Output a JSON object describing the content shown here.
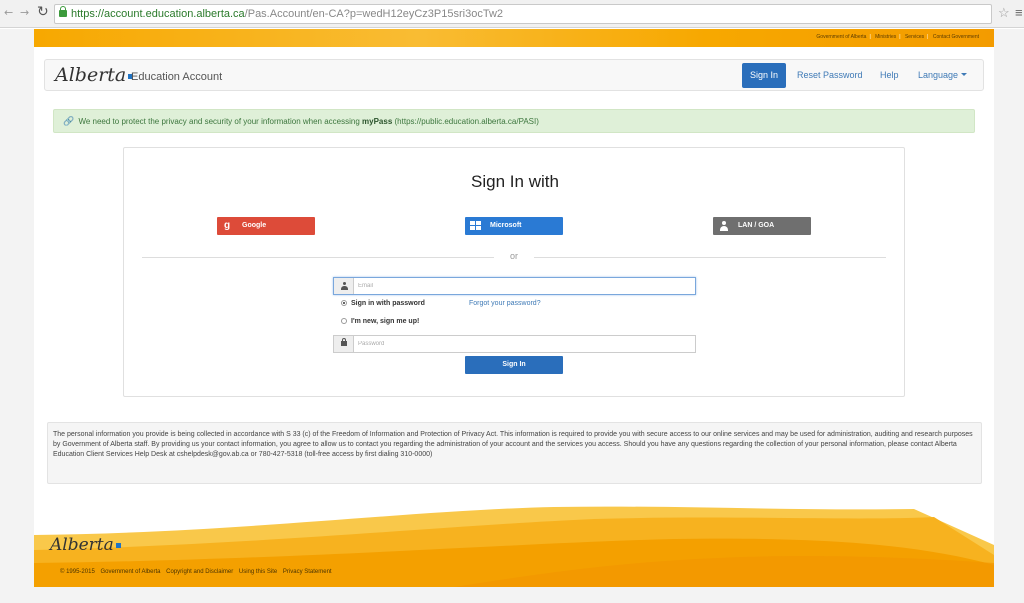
{
  "browser": {
    "url_host": "https://account.education.alberta.ca",
    "url_path": "/Pas.Account/en-CA?p=wedH12eyCz3P15sri3ocTw2"
  },
  "gov_links": [
    "Government of Alberta",
    "Ministries",
    "Services",
    "Contact Government"
  ],
  "navbar": {
    "logo": "Alberta",
    "title": "Education Account",
    "signin": "Sign In",
    "reset_password": "Reset Password",
    "help": "Help",
    "language": "Language"
  },
  "alert": {
    "text": "We need to protect the privacy and security of your information when accessing",
    "mypass": "myPass",
    "url": "(https://public.education.alberta.ca/PASI)"
  },
  "signin_panel": {
    "title": "Sign In with",
    "providers": {
      "google": "Google",
      "microsoft": "Microsoft",
      "lan": "LAN / GOA"
    },
    "or": "or",
    "email_placeholder": "Email",
    "radio_password": "Sign in with password",
    "radio_new": "I'm new, sign me up!",
    "forgot": "Forgot your password?",
    "password_placeholder": "Password",
    "signin_button": "Sign In"
  },
  "disclaimer": "The personal information you provide is being collected in accordance with S 33 (c) of the Freedom of Information and Protection of Privacy Act. This information is required to provide you with secure access to our online services and may be used for administration, auditing and research purposes by Government of Alberta staff. By providing us your contact information, you agree to allow us to contact you regarding the administration of your account and the services you access. Should you have any questions regarding the collection of your personal information, please contact Alberta Education Client Services Help Desk at cshelpdesk@gov.ab.ca or 780-427-5318 (toll-free access by first dialing 310-0000)",
  "footer": {
    "logo": "Alberta",
    "copyright": "© 1995-2015",
    "links": [
      "Government of Alberta",
      "Copyright and Disclaimer",
      "Using this Site",
      "Privacy Statement"
    ]
  },
  "colors": {
    "brand_blue": "#2a6ebb",
    "gov_yellow": "#f7a800",
    "google_red": "#dd4b39",
    "microsoft_blue": "#2a7ad4",
    "lan_gray": "#6f6f6f",
    "alert_green": "#dff0d8"
  }
}
